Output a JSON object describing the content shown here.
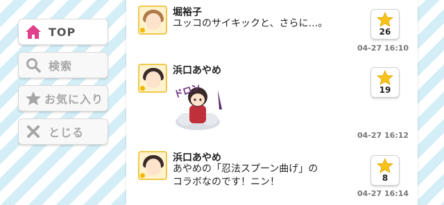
{
  "nav": {
    "items": [
      {
        "label": "TOP",
        "icon": "home-icon",
        "active": true
      },
      {
        "label": "検索",
        "icon": "search-icon",
        "active": false
      },
      {
        "label": "お気に入り",
        "icon": "star-icon",
        "active": false
      },
      {
        "label": "とじる",
        "icon": "close-icon",
        "active": false
      }
    ]
  },
  "colors": {
    "accent_pink": "#e0408c",
    "icon_gray": "#a6a6a6",
    "star_yellow": "#f7c21a"
  },
  "posts": [
    {
      "name": "堀裕子",
      "message": "ユッコのサイキックと、さらに…。",
      "likes": "26",
      "time": "04-27 16:10"
    },
    {
      "name": "浜口あやめ",
      "stamp_text": "ドロン",
      "likes": "19",
      "time": "04-27 16:12"
    },
    {
      "name": "浜口あやめ",
      "message": "あやめの「忍法スプーン曲げ」の\nコラボなのです！ニン！",
      "likes": "8",
      "time": "04-27 16:14"
    }
  ]
}
